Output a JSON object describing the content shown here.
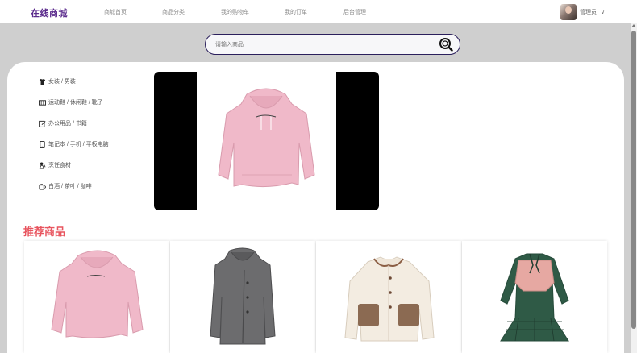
{
  "header": {
    "logo": "在线商城",
    "nav": [
      "商城首页",
      "商品分类",
      "我的购物车",
      "我的订单",
      "后台管理"
    ],
    "user_name": "管理员",
    "chevron": "∨"
  },
  "search": {
    "placeholder": "请输入商品",
    "icon": "search-icon"
  },
  "categories": [
    {
      "label": "女装 / 男装",
      "icon": "shirt-icon"
    },
    {
      "label": "运动鞋 / 休闲鞋 / 靴子",
      "icon": "shoe-box-icon"
    },
    {
      "label": "办公用品 / 书籍",
      "icon": "edit-icon"
    },
    {
      "label": "笔记本 / 手机 / 平板电脑",
      "icon": "phone-icon"
    },
    {
      "label": "烹饪食材",
      "icon": "chef-icon"
    },
    {
      "label": "白酒 / 茶叶 / 咖啡",
      "icon": "cup-icon"
    }
  ],
  "banner": {
    "image": "pink-hoodie"
  },
  "recommend": {
    "title": "推荐商品",
    "items": [
      {
        "image": "pink-hoodie"
      },
      {
        "image": "gray-coat"
      },
      {
        "image": "cream-fleece-jacket"
      },
      {
        "image": "green-plaid-dress"
      }
    ]
  },
  "colors": {
    "brand": "#5a2a8c",
    "accent": "#e8555f",
    "search_border": "#2b1f5c"
  }
}
